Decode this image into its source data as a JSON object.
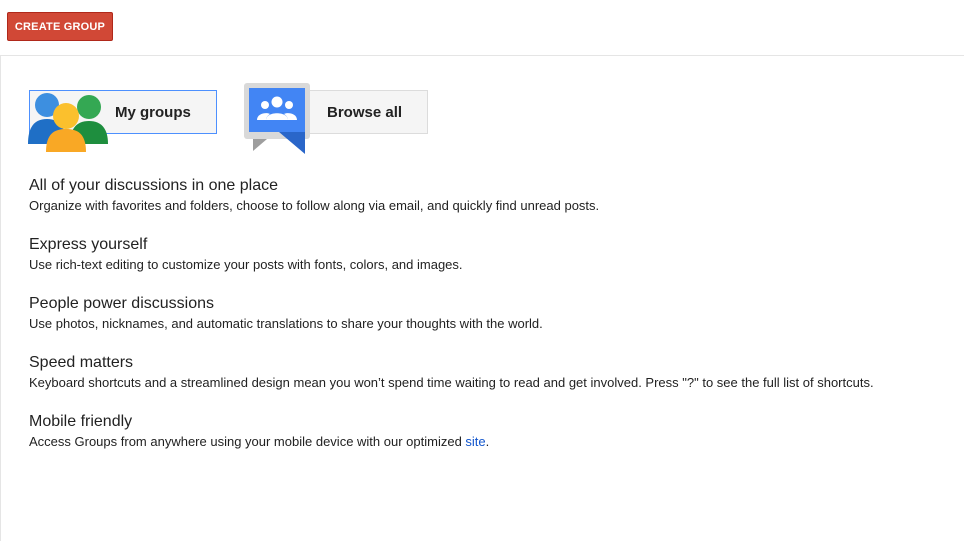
{
  "toolbar": {
    "create_group_label": "CREATE GROUP"
  },
  "cards": {
    "my_groups_label": "My groups",
    "browse_all_label": "Browse all"
  },
  "features": [
    {
      "title": "All of your discussions in one place",
      "body": "Organize with favorites and folders, choose to follow along via email, and quickly find unread posts."
    },
    {
      "title": "Express yourself",
      "body": "Use rich-text editing to customize your posts with fonts, colors, and images."
    },
    {
      "title": "People power discussions",
      "body": "Use photos, nicknames, and automatic translations to share your thoughts with the world."
    },
    {
      "title": "Speed matters",
      "body": "Keyboard shortcuts and a streamlined design mean you won’t spend time waiting to read and get involved. Press \"?\" to see the full list of shortcuts."
    },
    {
      "title": "Mobile friendly",
      "body_prefix": "Access Groups from anywhere using your mobile device with our optimized ",
      "link_text": "site",
      "body_suffix": "."
    }
  ],
  "colors": {
    "create_button": "#d14836",
    "link": "#1155cc",
    "selected_border": "#4d90fe",
    "browse_icon_blue": "#4285f4"
  },
  "icons": {
    "my_groups": "people-group-icon",
    "browse_all": "browse-groups-icon"
  }
}
